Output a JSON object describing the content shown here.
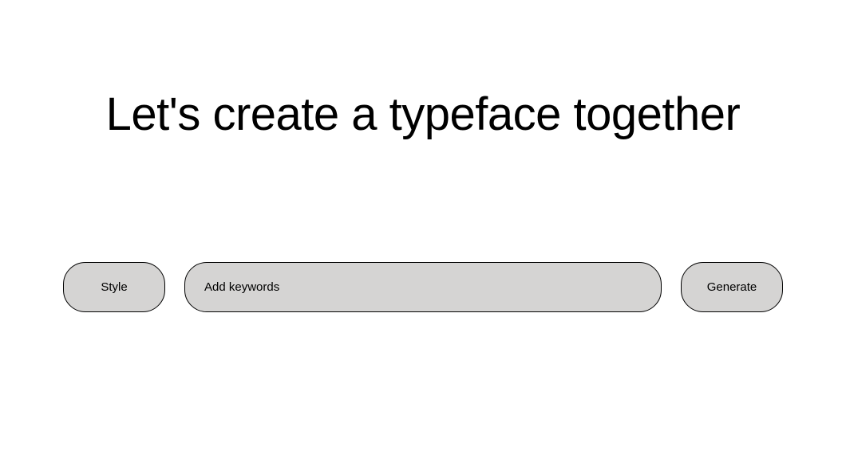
{
  "heading": "Let's create a typeface together",
  "controls": {
    "style_label": "Style",
    "keywords_placeholder": "Add keywords",
    "keywords_value": "",
    "generate_label": "Generate"
  }
}
